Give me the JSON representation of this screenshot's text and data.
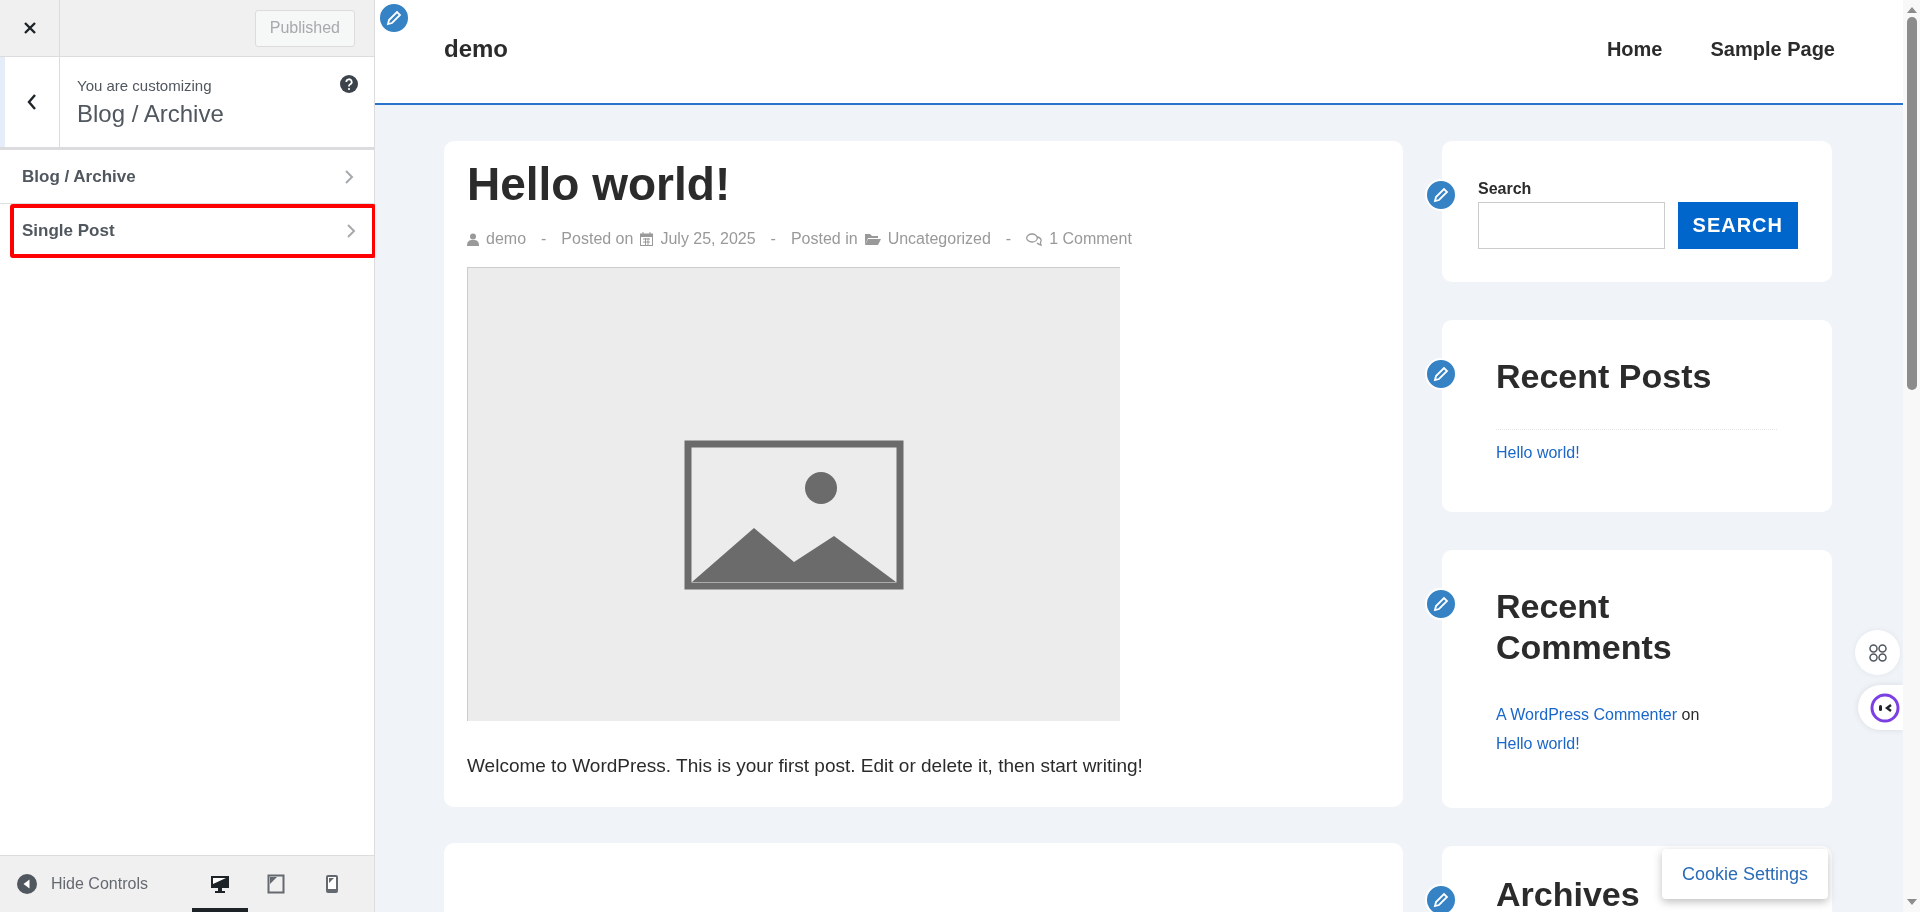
{
  "customizer": {
    "publish_button": {
      "label": "Published",
      "disabled": true
    },
    "context": {
      "caption": "You are customizing",
      "title": "Blog / Archive"
    },
    "sections": [
      {
        "label": "Blog / Archive",
        "highlighted": false
      },
      {
        "label": "Single Post",
        "highlighted": true
      }
    ],
    "footer": {
      "hide_controls": "Hide Controls",
      "devices": [
        {
          "kind": "desktop",
          "selected": true
        },
        {
          "kind": "tablet",
          "selected": false
        },
        {
          "kind": "mobile",
          "selected": false
        }
      ]
    }
  },
  "preview": {
    "site_title": "demo",
    "nav": [
      {
        "label": "Home"
      },
      {
        "label": "Sample Page"
      }
    ],
    "post": {
      "title": "Hello world!",
      "separator": "-",
      "meta": [
        {
          "kind": "author",
          "text": "demo"
        },
        {
          "kind": "date",
          "label": "Posted on",
          "text": "July 25, 2025"
        },
        {
          "kind": "category",
          "label": "Posted in",
          "text": "Uncategorized"
        },
        {
          "kind": "comments",
          "text": "1 Comment"
        }
      ],
      "excerpt": "Welcome to WordPress. This is your first post. Edit or delete it, then start writing!"
    },
    "widgets": [
      {
        "kind": "search",
        "label": "Search",
        "button": "SEARCH"
      },
      {
        "kind": "recent_posts",
        "title": "Recent Posts",
        "links": [
          "Hello world!"
        ]
      },
      {
        "kind": "recent_comments",
        "title": "Recent Comments",
        "comments": [
          {
            "author": "A WordPress Commenter",
            "on": "on",
            "post": "Hello world!"
          }
        ]
      },
      {
        "kind": "archives",
        "title": "Archives"
      }
    ],
    "cookie_button": "Cookie Settings"
  }
}
